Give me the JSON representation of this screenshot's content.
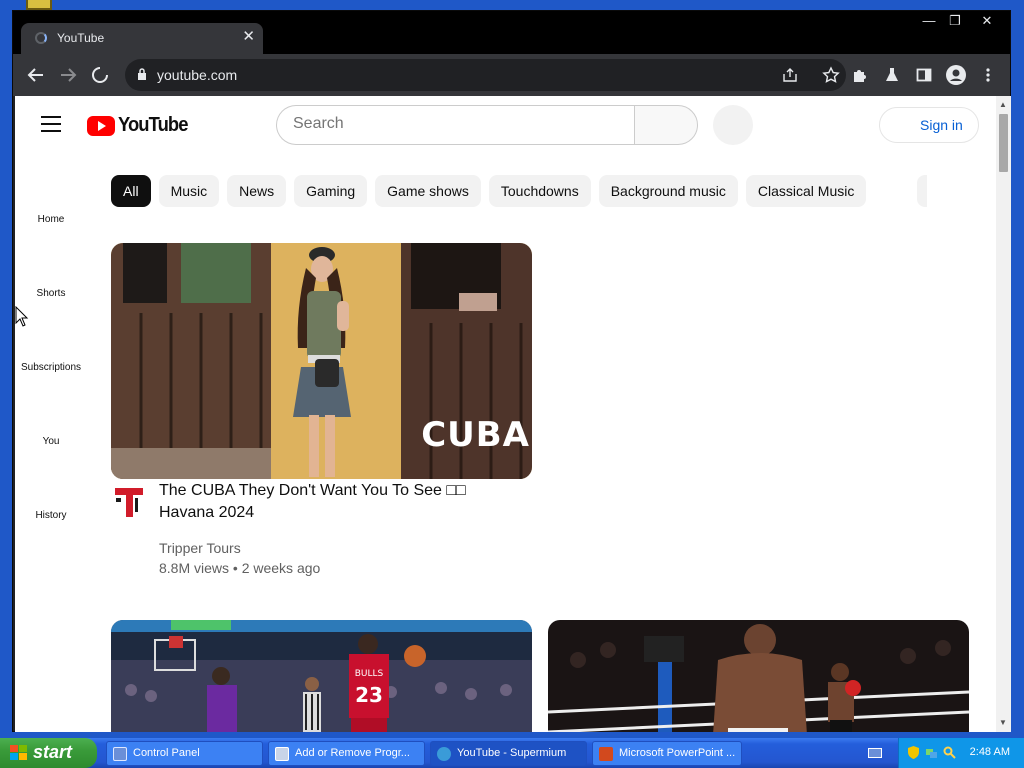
{
  "browser": {
    "tab_title": "YouTube",
    "tab_close": "✕",
    "url": "youtube.com",
    "win_minimize": "—",
    "win_maximize": "❐",
    "win_close": "✕"
  },
  "youtube": {
    "logo_text": "YouTube",
    "search_placeholder": "Search",
    "sign_in": "Sign in",
    "sidebar": [
      "Home",
      "Shorts",
      "Subscriptions",
      "You",
      "History"
    ],
    "chips": [
      "All",
      "Music",
      "News",
      "Gaming",
      "Game shows",
      "Touchdowns",
      "Background music",
      "Classical Music"
    ],
    "videos": [
      {
        "thumb_text": "CUBA",
        "title": "The CUBA They Don't Want You To See □□ Havana 2024",
        "channel": "Tripper Tours",
        "meta": "8.8M views • 2 weeks ago"
      }
    ],
    "jersey_number": "23",
    "jersey_team": "BULLS"
  },
  "taskbar": {
    "start": "start",
    "tasks": [
      "Control Panel",
      "Add or Remove Progr...",
      "YouTube - Supermium",
      "Microsoft PowerPoint ..."
    ],
    "clock": "2:48 AM"
  }
}
